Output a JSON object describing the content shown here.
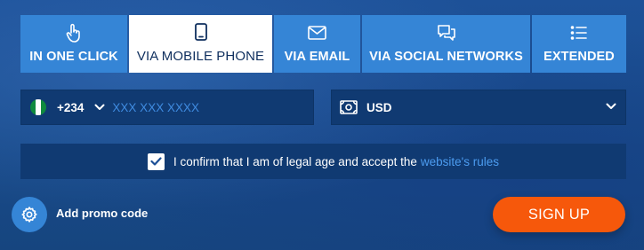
{
  "tabs": [
    {
      "label": "IN ONE CLICK",
      "icon": "pointer-hand-icon",
      "active": false
    },
    {
      "label": "VIA MOBILE PHONE",
      "icon": "mobile-phone-icon",
      "active": true
    },
    {
      "label": "VIA EMAIL",
      "icon": "envelope-icon",
      "active": false
    },
    {
      "label": "VIA SOCIAL NETWORKS",
      "icon": "chat-bubbles-icon",
      "active": false
    },
    {
      "label": "EXTENDED",
      "icon": "list-icon",
      "active": false
    }
  ],
  "phone": {
    "country_flag": "nigeria-flag-icon",
    "country_code": "+234",
    "number_value": "",
    "number_placeholder": "XXX XXX XXXX"
  },
  "currency": {
    "selected": "USD",
    "icon": "banknote-icon"
  },
  "confirm": {
    "checked": true,
    "text": "I confirm that I am of legal age and accept the",
    "link_text": "website's rules"
  },
  "promo": {
    "label": "Add promo code",
    "icon": "gear-icon"
  },
  "signup": {
    "label": "SIGN UP"
  },
  "colors": {
    "background": "#1c4f96",
    "tab": "#3585d6",
    "tab_active": "#ffffff",
    "field": "#103a72",
    "accent_link": "#4c9cf0",
    "signup_button": "#f6580b",
    "flag_green": "#0f8a3e"
  }
}
